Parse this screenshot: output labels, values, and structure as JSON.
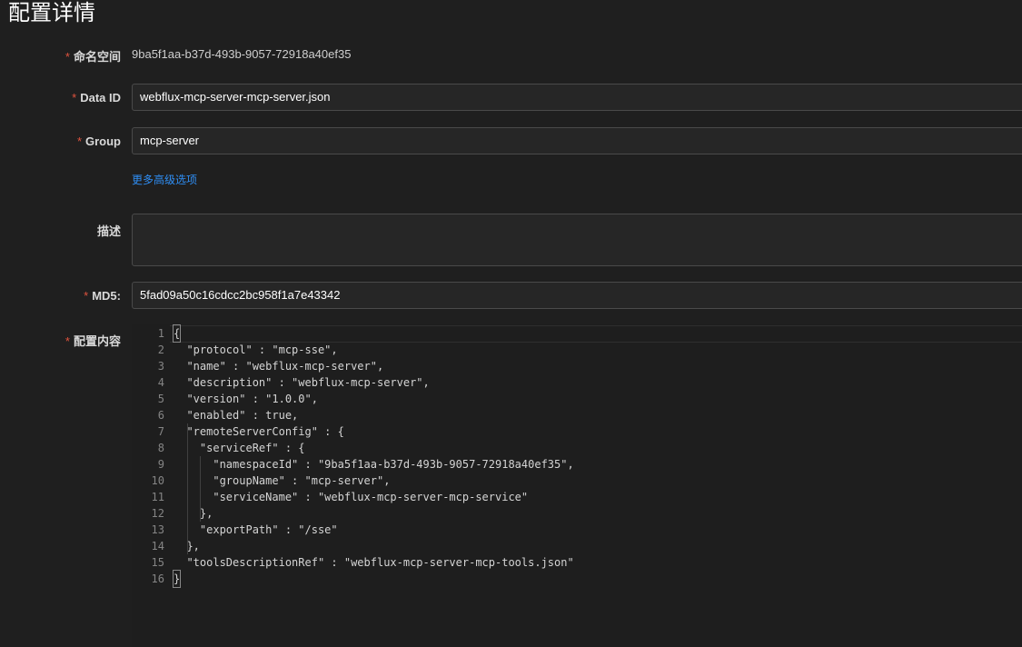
{
  "page_title": "配置详情",
  "form": {
    "namespace": {
      "label": "命名空间",
      "value": "9ba5f1aa-b37d-493b-9057-72918a40ef35"
    },
    "data_id": {
      "label": "Data ID",
      "value": "webflux-mcp-server-mcp-server.json"
    },
    "group": {
      "label": "Group",
      "value": "mcp-server"
    },
    "advanced_link": "更多高级选项",
    "description": {
      "label": "描述",
      "value": ""
    },
    "md5": {
      "label": "MD5:",
      "value": "5fad09a50c16cdcc2bc958f1a7e43342"
    },
    "content": {
      "label": "配置内容"
    },
    "required_mark": "*"
  },
  "editor": {
    "lines": [
      {
        "n": "1",
        "text": "{"
      },
      {
        "n": "2",
        "text": "  \"protocol\" : \"mcp-sse\","
      },
      {
        "n": "3",
        "text": "  \"name\" : \"webflux-mcp-server\","
      },
      {
        "n": "4",
        "text": "  \"description\" : \"webflux-mcp-server\","
      },
      {
        "n": "5",
        "text": "  \"version\" : \"1.0.0\","
      },
      {
        "n": "6",
        "text": "  \"enabled\" : true,"
      },
      {
        "n": "7",
        "text": "  \"remoteServerConfig\" : {"
      },
      {
        "n": "8",
        "text": "    \"serviceRef\" : {"
      },
      {
        "n": "9",
        "text": "      \"namespaceId\" : \"9ba5f1aa-b37d-493b-9057-72918a40ef35\","
      },
      {
        "n": "10",
        "text": "      \"groupName\" : \"mcp-server\","
      },
      {
        "n": "11",
        "text": "      \"serviceName\" : \"webflux-mcp-server-mcp-service\""
      },
      {
        "n": "12",
        "text": "    },"
      },
      {
        "n": "13",
        "text": "    \"exportPath\" : \"/sse\""
      },
      {
        "n": "14",
        "text": "  },"
      },
      {
        "n": "15",
        "text": "  \"toolsDescriptionRef\" : \"webflux-mcp-server-mcp-tools.json\""
      },
      {
        "n": "16",
        "text": "}"
      }
    ]
  }
}
